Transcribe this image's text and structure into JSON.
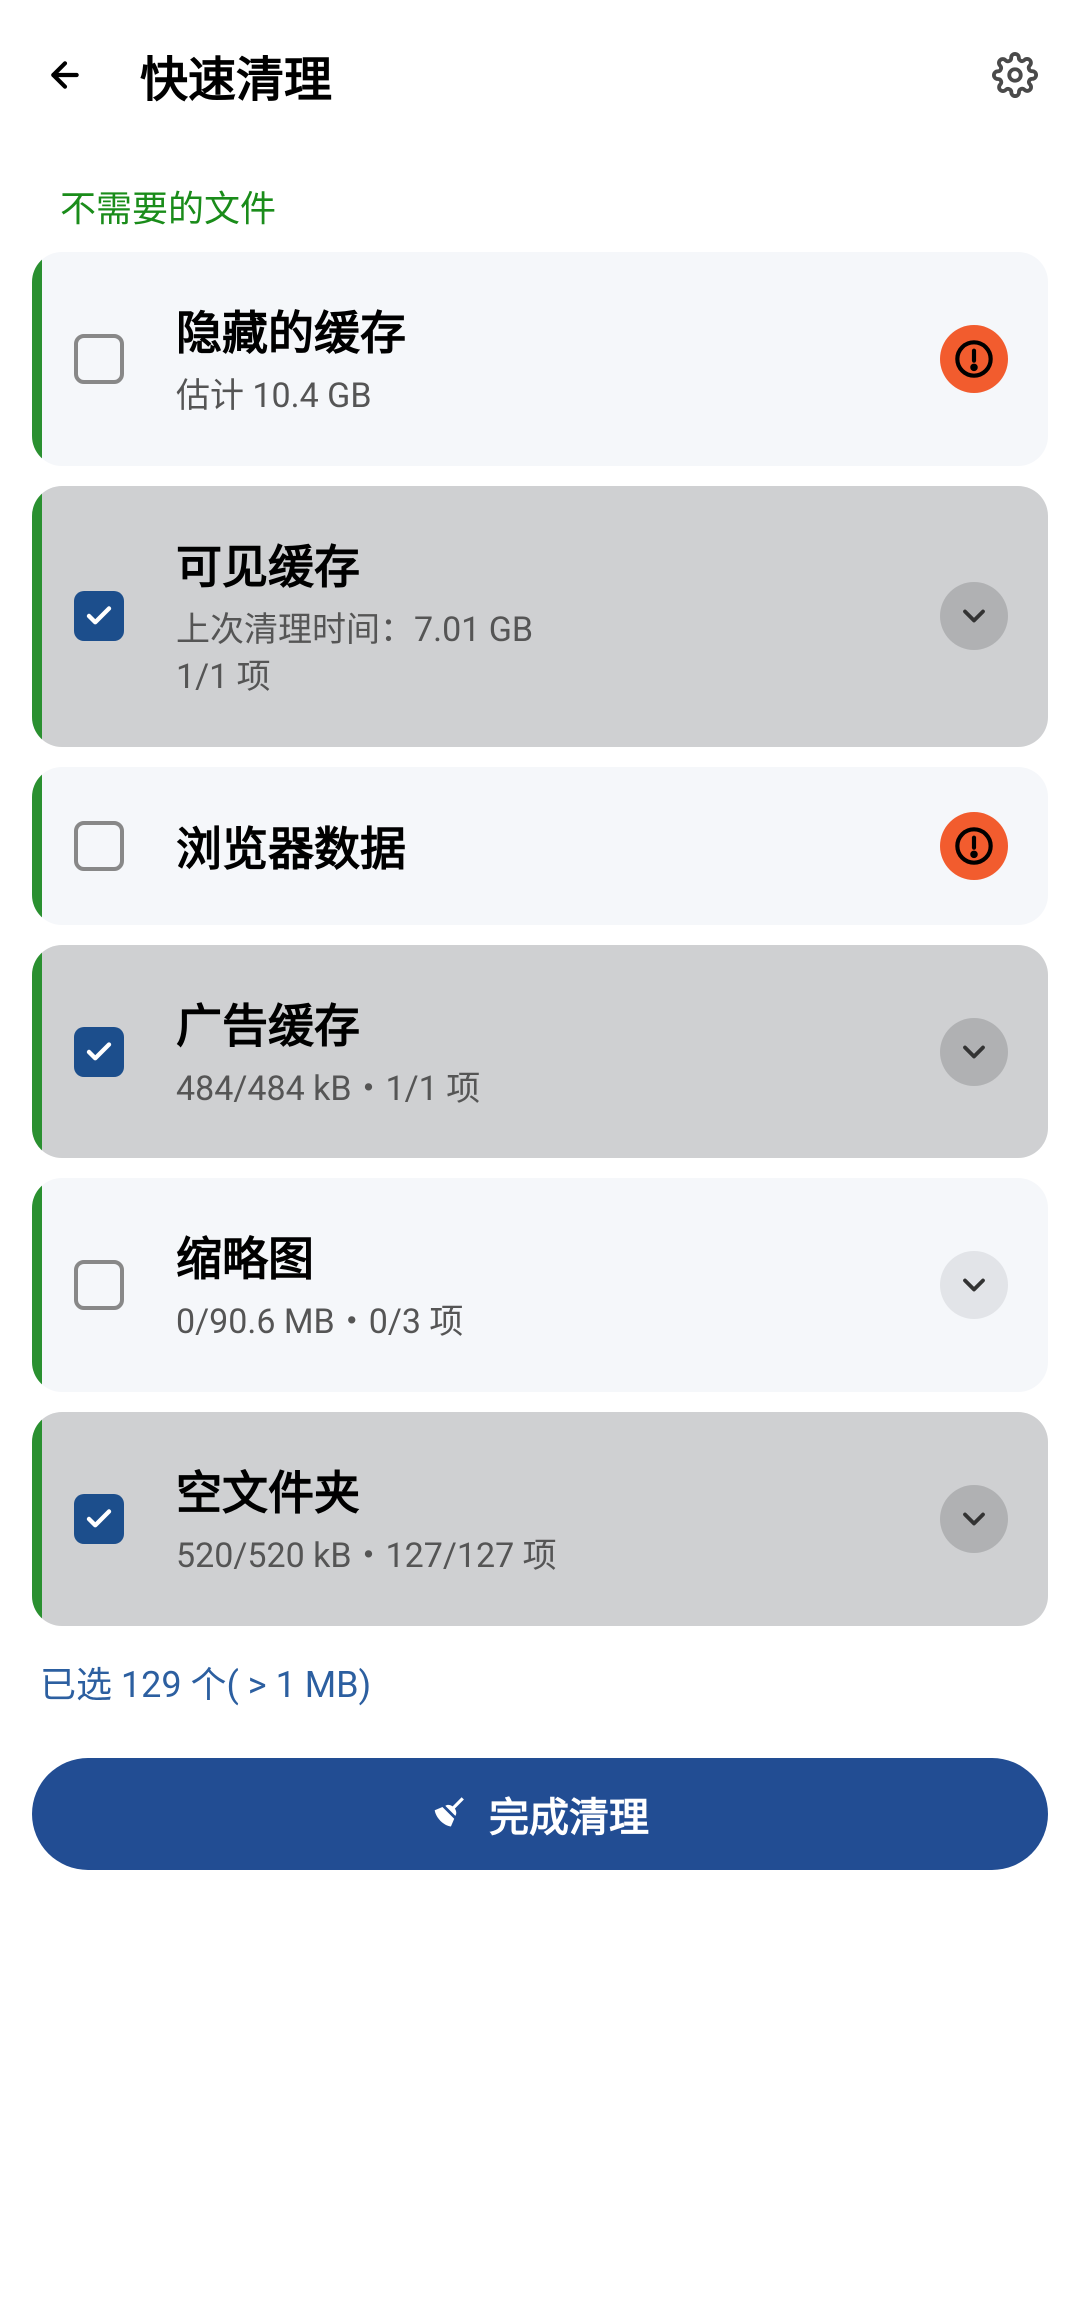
{
  "header": {
    "title": "快速清理"
  },
  "section": {
    "label": "不需要的文件"
  },
  "cards": [
    {
      "title": "隐藏的缓存",
      "subtitle": "估计 10.4 GB",
      "checked": false,
      "action": "alert"
    },
    {
      "title": "可见缓存",
      "subtitle": "上次清理时间：7.01 GB\n1/1 项",
      "checked": true,
      "action": "expand"
    },
    {
      "title": "浏览器数据",
      "subtitle": "",
      "checked": false,
      "action": "alert"
    },
    {
      "title": "广告缓存",
      "subtitle": "484/484 kB・1/1 项",
      "checked": true,
      "action": "expand"
    },
    {
      "title": "缩略图",
      "subtitle": "0/90.6 MB・0/3 项",
      "checked": false,
      "action": "expand"
    },
    {
      "title": "空文件夹",
      "subtitle": "520/520 kB・127/127 项",
      "checked": true,
      "action": "expand"
    }
  ],
  "summary": "已选 129 个( > 1 MB)",
  "button": {
    "label": "完成清理"
  }
}
